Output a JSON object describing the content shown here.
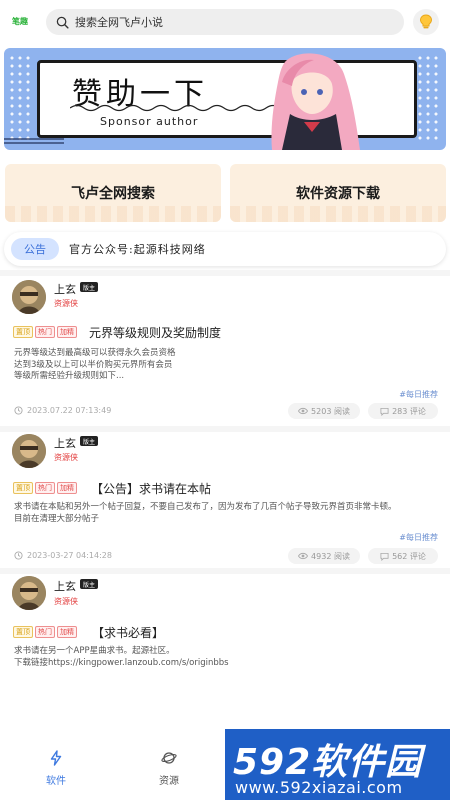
{
  "header": {
    "logo_text": "笔趣",
    "search_placeholder": "搜索全网飞卢小说",
    "accent": "#3f7ae0"
  },
  "banner": {
    "title": "赞助一下",
    "subtitle": "Sponsor author"
  },
  "quick_buttons": [
    {
      "label": "飞卢全网搜索"
    },
    {
      "label": "软件资源下载"
    }
  ],
  "notice": {
    "tag": "公告",
    "text": "官方公众号:起源科技网络"
  },
  "posts": [
    {
      "user": "上玄",
      "level": "版主",
      "user_tag": "资源侠",
      "tags": [
        "置顶",
        "热门",
        "加精"
      ],
      "title": "元界等级规则及奖励制度",
      "body": [
        "元界等级达到最高级可以获得永久会员资格",
        "达到3级及以上可以半价购买元界所有会员",
        "等级所需经验升级规则如下..."
      ],
      "topic": "#每日推荐",
      "time": "2023.07.22 07:13:49",
      "views": "5203 阅读",
      "comments": "283 评论"
    },
    {
      "user": "上玄",
      "level": "版主",
      "user_tag": "资源侠",
      "tags": [
        "置顶",
        "热门",
        "加精"
      ],
      "title": "【公告】求书请在本帖",
      "body": [
        "求书请在本贴和另外一个帖子回复，不要自己发布了，因为发布了几百个帖子导致元界首页非常卡顿。",
        "目前在清理大部分帖子"
      ],
      "topic": "#每日推荐",
      "time": "2023-03-27 04:14:28",
      "views": "4932 阅读",
      "comments": "562 评论"
    },
    {
      "user": "上玄",
      "level": "版主",
      "user_tag": "资源侠",
      "tags": [
        "置顶",
        "热门",
        "加精"
      ],
      "title": "【求书必看】",
      "body": [
        "求书请在另一个APP星曲求书。起源社区。",
        "下载链接https://kingpower.lanzoub.com/s/originbbs"
      ]
    }
  ],
  "bottom_nav": [
    {
      "label": "软件",
      "active": true
    },
    {
      "label": "资源",
      "active": false
    }
  ],
  "watermark": {
    "big": "592软件园",
    "small": "www.592xiazai.com"
  }
}
